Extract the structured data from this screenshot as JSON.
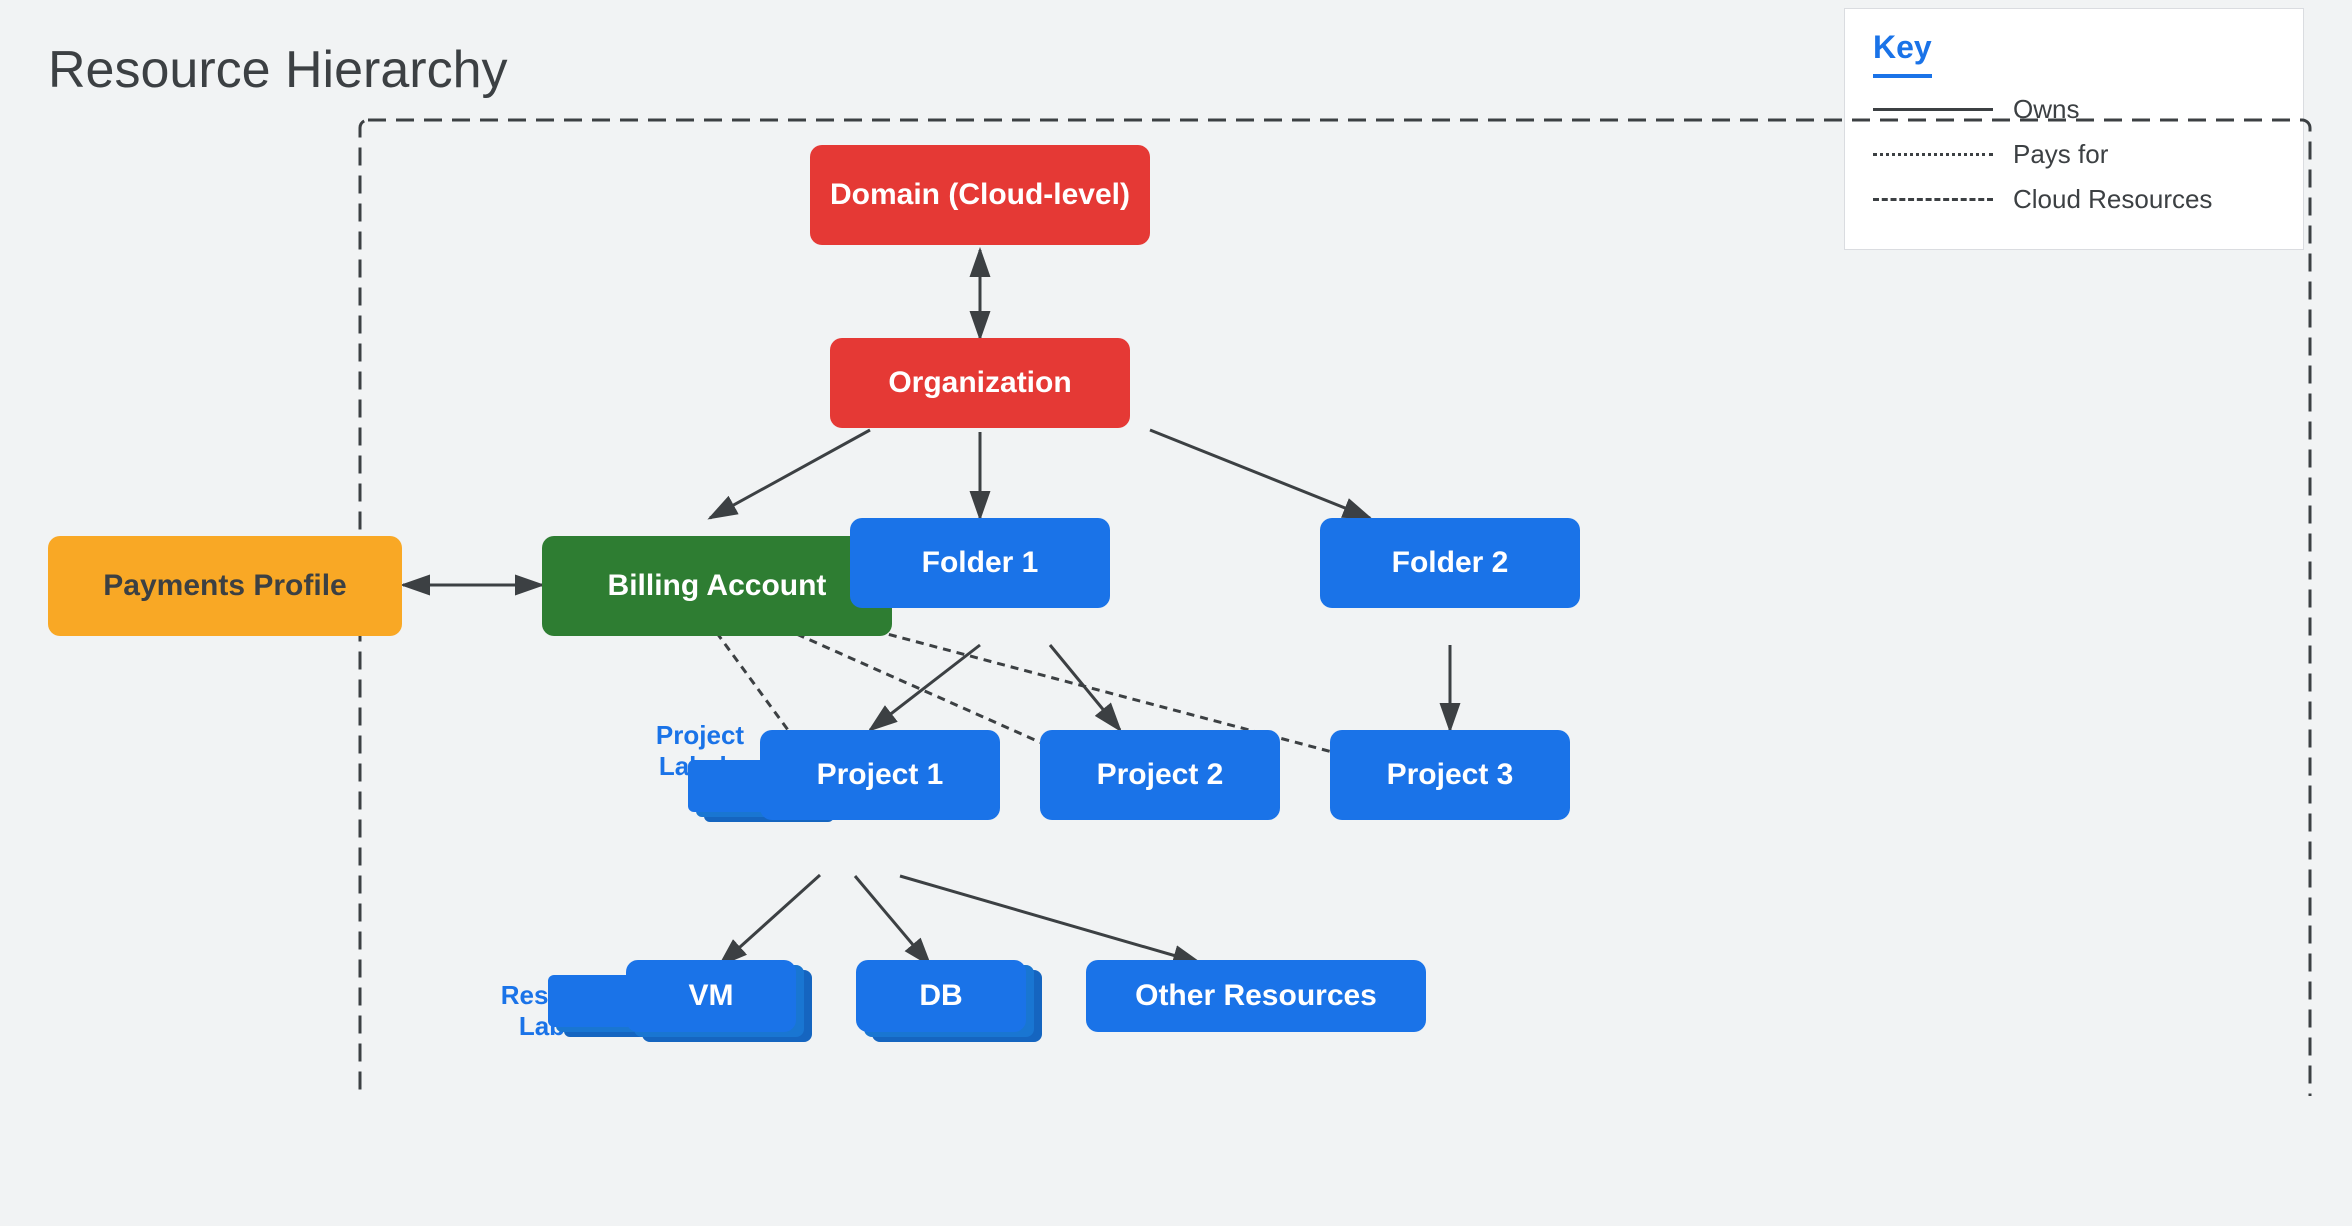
{
  "page": {
    "title": "Resource Hierarchy",
    "background_color": "#f1f3f4"
  },
  "key": {
    "title": "Key",
    "items": [
      {
        "line_type": "solid",
        "label": "Owns"
      },
      {
        "line_type": "dotted",
        "label": "Pays for"
      },
      {
        "line_type": "dashed",
        "label": "Cloud Resources"
      }
    ]
  },
  "nodes": {
    "domain": {
      "label": "Domain (Cloud-level)",
      "type": "red"
    },
    "organization": {
      "label": "Organization",
      "type": "red"
    },
    "payments_profile": {
      "label": "Payments Profile",
      "type": "yellow"
    },
    "billing_account": {
      "label": "Billing Account",
      "type": "green"
    },
    "folder1": {
      "label": "Folder 1",
      "type": "blue"
    },
    "folder2": {
      "label": "Folder 2",
      "type": "blue"
    },
    "project1": {
      "label": "Project 1",
      "type": "blue"
    },
    "project2": {
      "label": "Project 2",
      "type": "blue"
    },
    "project3": {
      "label": "Project 3",
      "type": "blue"
    },
    "vm": {
      "label": "VM",
      "type": "blue"
    },
    "db": {
      "label": "DB",
      "type": "blue"
    },
    "other_resources": {
      "label": "Other Resources",
      "type": "blue"
    }
  },
  "labels": {
    "project_labels": "Project\nLabels",
    "resource_labels": "Resource\nLabels"
  }
}
